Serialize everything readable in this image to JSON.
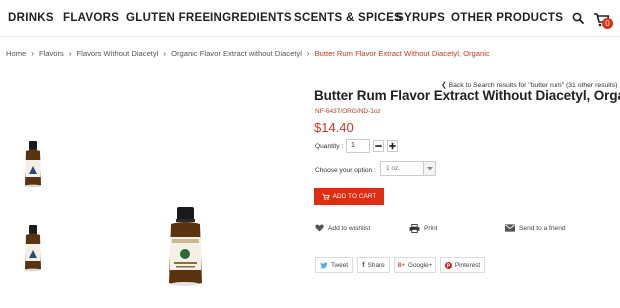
{
  "nav": {
    "items": [
      "DRINKS",
      "FLAVORS",
      "GLUTEN FREE",
      "INGREDIENTS",
      "SCENTS & SPICES",
      "SYRUPS",
      "OTHER PRODUCTS"
    ],
    "cart_count": "0"
  },
  "breadcrumb": {
    "home": "Home",
    "flavors": "Flavors",
    "without_diacetyl": "Flavors Without Diacetyl",
    "organic": "Organic Flavor Extract without Diacetyl",
    "current": "Butter Rum Flavor Extract Without Diacetyl, Organic"
  },
  "product": {
    "back_link": "Back to Search results for \"butter rum\" (31 other results)",
    "title": "Butter Rum Flavor Extract Without Diacetyl, Organic",
    "sku": "NF-6437/ORG/ND-1oz",
    "price": "$14.40",
    "quantity_label": "Quantity :",
    "quantity_value": "1",
    "option_label": "Choose your option :",
    "option_value": "1 oz.",
    "add_to_cart": "ADD TO CART"
  },
  "actions": {
    "wishlist": "Add to wishlist",
    "print": "Print",
    "send": "Send to a friend"
  },
  "share": {
    "tweet": "Tweet",
    "share": "Share",
    "google": "Google+",
    "pinterest": "Pinterest"
  },
  "colors": {
    "accent": "#e02d10",
    "price": "#cc3a1e",
    "twitter": "#55acee",
    "facebook": "#3b5998",
    "google": "#dd4b39",
    "pinterest": "#cb2027"
  }
}
